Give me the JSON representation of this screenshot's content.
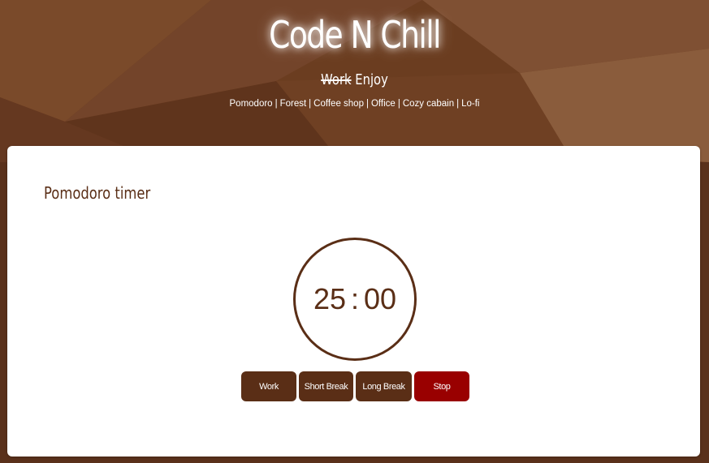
{
  "header": {
    "title": "Code N Chill",
    "tagline_struck": "Work",
    "tagline_rest": "Enjoy",
    "nav": [
      "Pomodoro",
      "Forest",
      "Coffee shop",
      "Office",
      "Cozy cabain",
      "Lo-fi"
    ],
    "separator": "|"
  },
  "timer": {
    "title": "Pomodoro timer",
    "minutes": "25",
    "colon": ":",
    "seconds": "00",
    "buttons": {
      "work": "Work",
      "short_break": "Short Break",
      "long_break": "Long Break",
      "stop": "Stop"
    }
  },
  "colors": {
    "background": "#6e4024",
    "accent": "#5a2e16",
    "stop": "#990000",
    "card": "#ffffff"
  }
}
